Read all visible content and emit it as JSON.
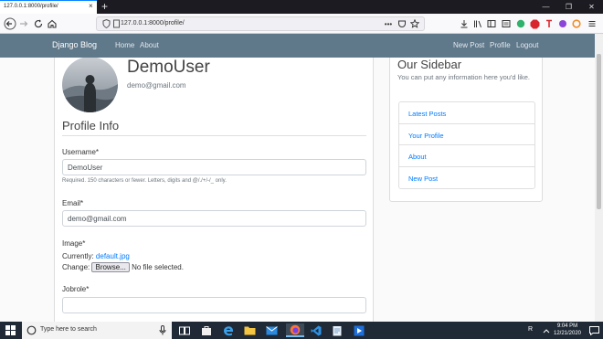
{
  "browser": {
    "tab_title": "127.0.0.1:8000/profile/",
    "tab_close": "×",
    "new_tab": "+",
    "url": "127.0.0.1:8000/profile/",
    "win_min": "—",
    "win_max": "❐",
    "win_close": "✕"
  },
  "site_nav": {
    "brand": "Django Blog",
    "left_links": [
      "Home",
      "About"
    ],
    "right_links": [
      "New Post",
      "Profile",
      "Logout"
    ]
  },
  "profile": {
    "username": "DemoUser",
    "email": "demo@gmail.com"
  },
  "form": {
    "section_title": "Profile Info",
    "username_label": "Username*",
    "username_value": "DemoUser",
    "username_help": "Required. 150 characters or fewer. Letters, digits and @/./+/-/_ only.",
    "email_label": "Email*",
    "email_value": "demo@gmail.com",
    "image_label": "Image*",
    "currently_label": "Currently:",
    "currently_value": "default.jpg",
    "change_label": "Change:",
    "browse_label": "Browse...",
    "no_file_label": "No file selected.",
    "jobrole_label": "Jobrole*",
    "jobrole_value": ""
  },
  "sidebar": {
    "title": "Our Sidebar",
    "description": "You can put any information here you'd like.",
    "items": [
      "Latest Posts",
      "Your Profile",
      "About",
      "New Post"
    ]
  },
  "taskbar": {
    "search_placeholder": "Type here to search",
    "time": "9:04 PM",
    "date": "12/21/2020",
    "tray_label": "R"
  },
  "colors": {
    "site_nav": "#5f788a",
    "link": "#007bff",
    "taskbar": "#1f2a36"
  }
}
